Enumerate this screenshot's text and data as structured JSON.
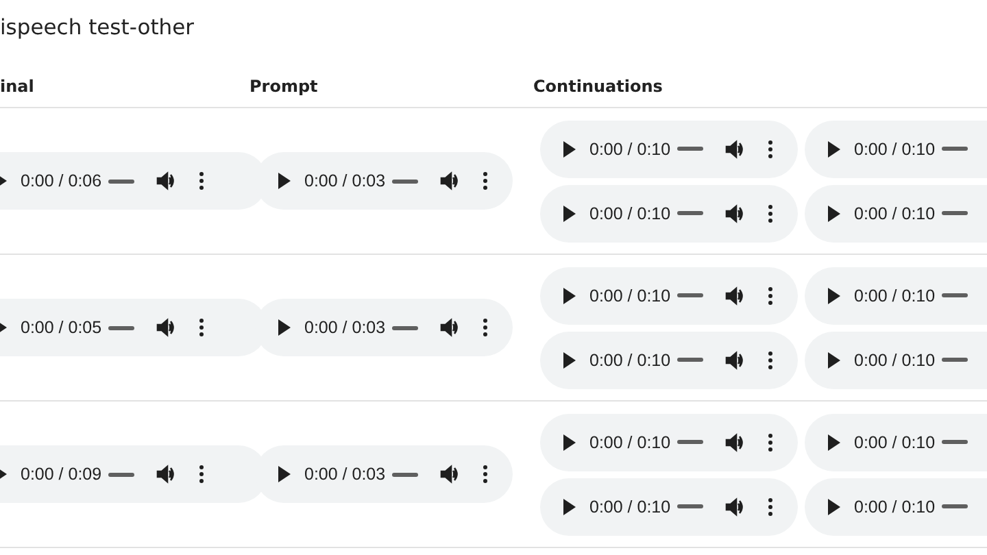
{
  "title": "ispeech test-other",
  "columns": [
    "inal",
    "Prompt",
    "Continuations"
  ],
  "rows": [
    {
      "original": {
        "time": "0:00 / 0:06",
        "level": 0
      },
      "prompt": {
        "time": "0:00 / 0:03",
        "level": 0
      },
      "continuations": [
        {
          "time": "0:00 / 0:10",
          "level": 0
        },
        {
          "time": "0:00 / 0:10",
          "level": 0
        },
        {
          "time": "0:00 / 0:10",
          "level": 0
        },
        {
          "time": "0:00 / 0:10",
          "level": 0
        }
      ]
    },
    {
      "original": {
        "time": "0:00 / 0:05",
        "level": 0
      },
      "prompt": {
        "time": "0:00 / 0:03",
        "level": 0
      },
      "continuations": [
        {
          "time": "0:00 / 0:10",
          "level": 0
        },
        {
          "time": "0:00 / 0:10",
          "level": 0
        },
        {
          "time": "0:00 / 0:10",
          "level": 0
        },
        {
          "time": "0:00 / 0:10",
          "level": 0
        }
      ]
    },
    {
      "original": {
        "time": "0:00 / 0:09",
        "level": 0
      },
      "prompt": {
        "time": "0:00 / 0:03",
        "level": 0
      },
      "continuations": [
        {
          "time": "0:00 / 0:10",
          "level": 0
        },
        {
          "time": "0:00 / 0:10",
          "level": 0
        },
        {
          "time": "0:00 / 0:10",
          "level": 0
        },
        {
          "time": "0:00 / 0:10",
          "level": 0
        }
      ]
    }
  ]
}
